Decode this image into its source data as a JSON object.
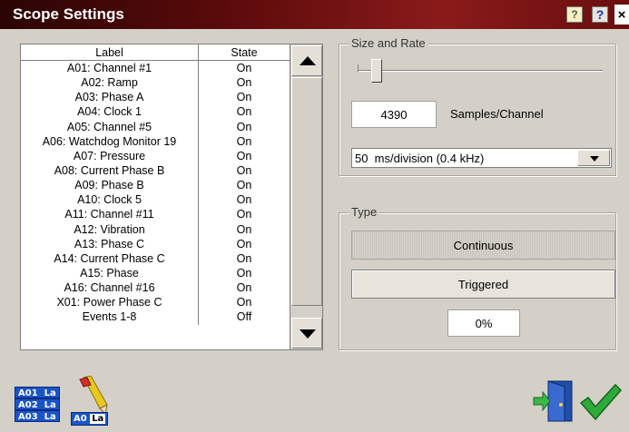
{
  "window": {
    "title": "Scope Settings",
    "help_icon": "help-book-icon",
    "whats_this_icon": "question-mark-icon",
    "close_glyph": "×"
  },
  "channel_list": {
    "headers": {
      "label": "Label",
      "state": "State"
    },
    "rows": [
      {
        "label": "A01: Channel #1",
        "state": "On"
      },
      {
        "label": "A02: Ramp",
        "state": "On"
      },
      {
        "label": "A03: Phase A",
        "state": "On"
      },
      {
        "label": "A04: Clock 1",
        "state": "On"
      },
      {
        "label": "A05: Channel #5",
        "state": "On"
      },
      {
        "label": "A06: Watchdog Monitor 19",
        "state": "On"
      },
      {
        "label": "A07: Pressure",
        "state": "On"
      },
      {
        "label": "A08: Current Phase B",
        "state": "On"
      },
      {
        "label": "A09: Phase B",
        "state": "On"
      },
      {
        "label": "A10: Clock 5",
        "state": "On"
      },
      {
        "label": "A11: Channel #11",
        "state": "On"
      },
      {
        "label": "A12: Vibration",
        "state": "On"
      },
      {
        "label": "A13: Phase C",
        "state": "On"
      },
      {
        "label": "A14: Current Phase C",
        "state": "On"
      },
      {
        "label": "A15: Phase",
        "state": "On"
      },
      {
        "label": "A16: Channel #16",
        "state": "On"
      },
      {
        "label": "X01: Power Phase C",
        "state": "On"
      },
      {
        "label": "Events 1-8",
        "state": "Off"
      }
    ]
  },
  "size_and_rate": {
    "legend": "Size and Rate",
    "samples_value": "4390",
    "samples_label": "Samples/Channel",
    "rate_selected": "50  ms/division (0.4 kHz)"
  },
  "type": {
    "legend": "Type",
    "continuous_label": "Continuous",
    "triggered_label": "Triggered",
    "trigger_percent": "0%"
  },
  "toolbar": {
    "labels_icon_lines": [
      "A01  La",
      "A02  La",
      "A03  La"
    ],
    "eraser_tag_prefix": "A0",
    "eraser_tag_suffix": "La"
  },
  "colors": {
    "title_bar": "#5a0a0a",
    "dialog_bg": "#d4d0c8",
    "tile_blue": "#1a54c8",
    "ok_green": "#2eaa3a",
    "door_blue": "#1f4fa8"
  }
}
